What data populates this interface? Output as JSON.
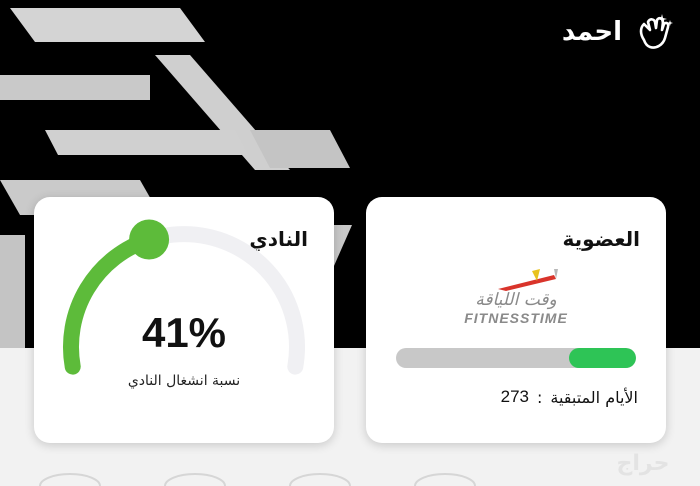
{
  "user": {
    "name": "احمد",
    "greeting_icon": "waving-hand-icon"
  },
  "club_card": {
    "title": "النادي",
    "occupancy_percent": 41,
    "occupancy_display": "41%",
    "caption": "نسبة انشغال النادي",
    "gauge_color": "#5dbb3a",
    "track_color": "#f0f0f3"
  },
  "membership_card": {
    "title": "العضوية",
    "brand_arabic": "وقت اللياقة",
    "brand_latin": "FITNESSTIME",
    "remaining_fraction": 0.28,
    "progress_color": "#2ec456",
    "remaining_days_label": "الأيام المتبقية",
    "separator": ":",
    "remaining_days_value": "273"
  },
  "watermark": {
    "text": "حراج"
  }
}
